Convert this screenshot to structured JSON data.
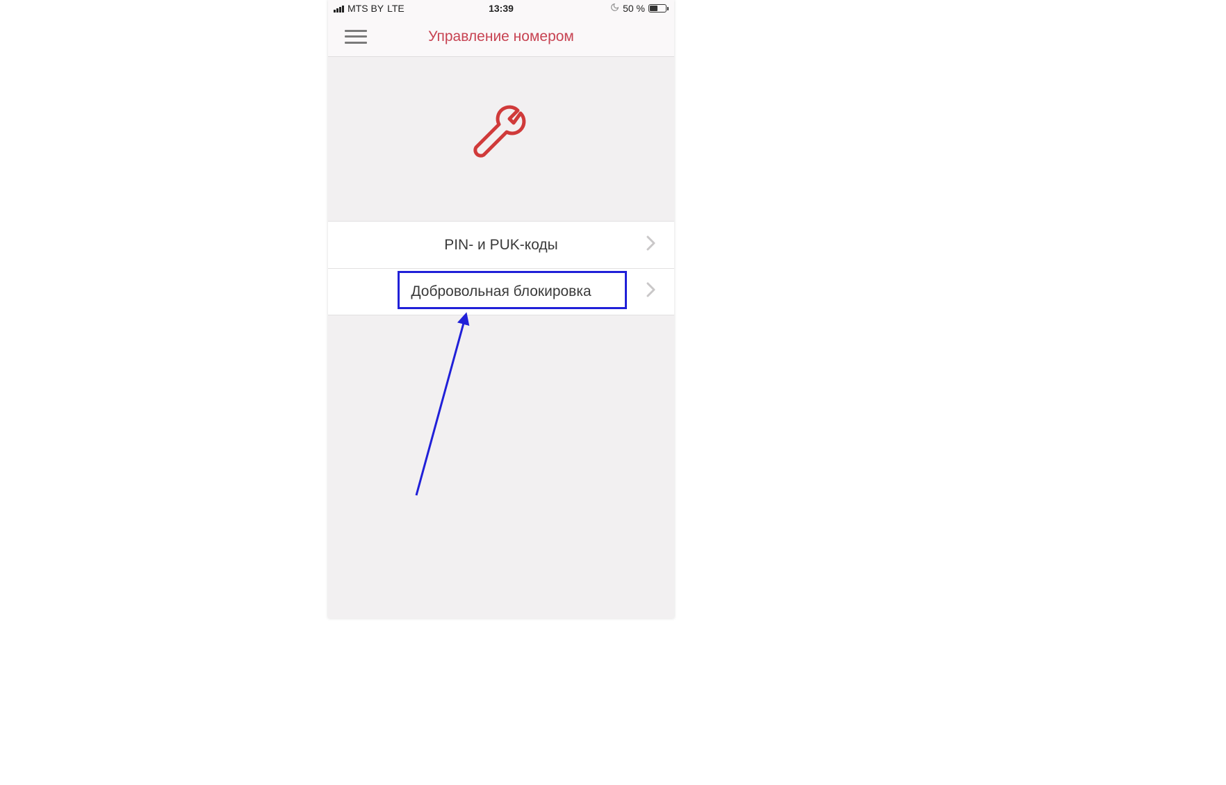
{
  "status_bar": {
    "carrier": "MTS BY",
    "network": "LTE",
    "time": "13:39",
    "battery_text": "50 %"
  },
  "nav": {
    "title": "Управление номером"
  },
  "menu": {
    "items": [
      {
        "label": "PIN- и PUK-коды"
      },
      {
        "label": "Добровольная блокировка"
      }
    ]
  },
  "colors": {
    "accent": "#c74352",
    "annotation": "#2020d8"
  }
}
